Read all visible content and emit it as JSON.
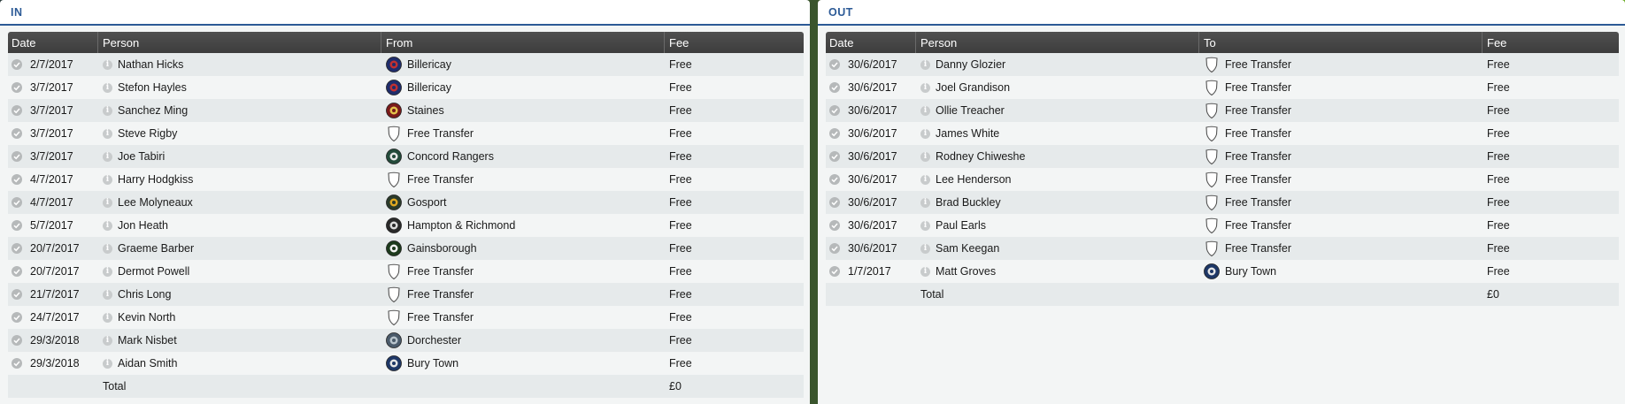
{
  "in_panel": {
    "title": "IN",
    "headers": {
      "date": "Date",
      "person": "Person",
      "club": "From",
      "fee": "Fee"
    },
    "rows": [
      {
        "date": "2/7/2017",
        "person": "Nathan Hicks",
        "club": "Billericay",
        "crest": "billericay-crest-icon",
        "fee": "Free"
      },
      {
        "date": "3/7/2017",
        "person": "Stefon Hayles",
        "club": "Billericay",
        "crest": "billericay-crest-icon",
        "fee": "Free"
      },
      {
        "date": "3/7/2017",
        "person": "Sanchez Ming",
        "club": "Staines",
        "crest": "staines-crest-icon",
        "fee": "Free"
      },
      {
        "date": "3/7/2017",
        "person": "Steve Rigby",
        "club": "Free Transfer",
        "crest": "blank-shield-icon",
        "fee": "Free"
      },
      {
        "date": "3/7/2017",
        "person": "Joe Tabiri",
        "club": "Concord Rangers",
        "crest": "concord-rangers-crest-icon",
        "fee": "Free"
      },
      {
        "date": "4/7/2017",
        "person": "Harry Hodgkiss",
        "club": "Free Transfer",
        "crest": "blank-shield-icon",
        "fee": "Free"
      },
      {
        "date": "4/7/2017",
        "person": "Lee Molyneaux",
        "club": "Gosport",
        "crest": "gosport-crest-icon",
        "fee": "Free"
      },
      {
        "date": "5/7/2017",
        "person": "Jon Heath",
        "club": "Hampton & Richmond",
        "crest": "hampton-richmond-crest-icon",
        "fee": "Free"
      },
      {
        "date": "20/7/2017",
        "person": "Graeme Barber",
        "club": "Gainsborough",
        "crest": "gainsborough-crest-icon",
        "fee": "Free"
      },
      {
        "date": "20/7/2017",
        "person": "Dermot Powell",
        "club": "Free Transfer",
        "crest": "blank-shield-icon",
        "fee": "Free"
      },
      {
        "date": "21/7/2017",
        "person": "Chris Long",
        "club": "Free Transfer",
        "crest": "blank-shield-icon",
        "fee": "Free"
      },
      {
        "date": "24/7/2017",
        "person": "Kevin North",
        "club": "Free Transfer",
        "crest": "blank-shield-icon",
        "fee": "Free"
      },
      {
        "date": "29/3/2018",
        "person": "Mark Nisbet",
        "club": "Dorchester",
        "crest": "dorchester-crest-icon",
        "fee": "Free"
      },
      {
        "date": "29/3/2018",
        "person": "Aidan Smith",
        "club": "Bury Town",
        "crest": "bury-town-crest-icon",
        "fee": "Free"
      }
    ],
    "total": {
      "label": "Total",
      "fee": "£0"
    }
  },
  "out_panel": {
    "title": "OUT",
    "headers": {
      "date": "Date",
      "person": "Person",
      "club": "To",
      "fee": "Fee"
    },
    "rows": [
      {
        "date": "30/6/2017",
        "person": "Danny Glozier",
        "club": "Free Transfer",
        "crest": "blank-shield-icon",
        "fee": "Free"
      },
      {
        "date": "30/6/2017",
        "person": "Joel Grandison",
        "club": "Free Transfer",
        "crest": "blank-shield-icon",
        "fee": "Free"
      },
      {
        "date": "30/6/2017",
        "person": "Ollie Treacher",
        "club": "Free Transfer",
        "crest": "blank-shield-icon",
        "fee": "Free"
      },
      {
        "date": "30/6/2017",
        "person": "James White",
        "club": "Free Transfer",
        "crest": "blank-shield-icon",
        "fee": "Free"
      },
      {
        "date": "30/6/2017",
        "person": "Rodney Chiweshe",
        "club": "Free Transfer",
        "crest": "blank-shield-icon",
        "fee": "Free"
      },
      {
        "date": "30/6/2017",
        "person": "Lee Henderson",
        "club": "Free Transfer",
        "crest": "blank-shield-icon",
        "fee": "Free"
      },
      {
        "date": "30/6/2017",
        "person": "Brad Buckley",
        "club": "Free Transfer",
        "crest": "blank-shield-icon",
        "fee": "Free"
      },
      {
        "date": "30/6/2017",
        "person": "Paul Earls",
        "club": "Free Transfer",
        "crest": "blank-shield-icon",
        "fee": "Free"
      },
      {
        "date": "30/6/2017",
        "person": "Sam Keegan",
        "club": "Free Transfer",
        "crest": "blank-shield-icon",
        "fee": "Free"
      },
      {
        "date": "1/7/2017",
        "person": "Matt Groves",
        "club": "Bury Town",
        "crest": "bury-town-crest-icon",
        "fee": "Free"
      }
    ],
    "total": {
      "label": "Total",
      "fee": "£0"
    }
  },
  "crest_colors": {
    "billericay-crest-icon": [
      "#1f2d6b",
      "#c23030"
    ],
    "staines-crest-icon": [
      "#7a1a1a",
      "#e4c24a"
    ],
    "concord-rangers-crest-icon": [
      "#234a3a",
      "#e8e8e8"
    ],
    "gosport-crest-icon": [
      "#2a3a2a",
      "#e0a820"
    ],
    "hampton-richmond-crest-icon": [
      "#2a2a2a",
      "#dcdcdc"
    ],
    "gainsborough-crest-icon": [
      "#1c3a1c",
      "#f2f2f2"
    ],
    "dorchester-crest-icon": [
      "#4a5a6a",
      "#b8c4cc"
    ],
    "bury-town-crest-icon": [
      "#1e3766",
      "#e6e6e6"
    ]
  }
}
